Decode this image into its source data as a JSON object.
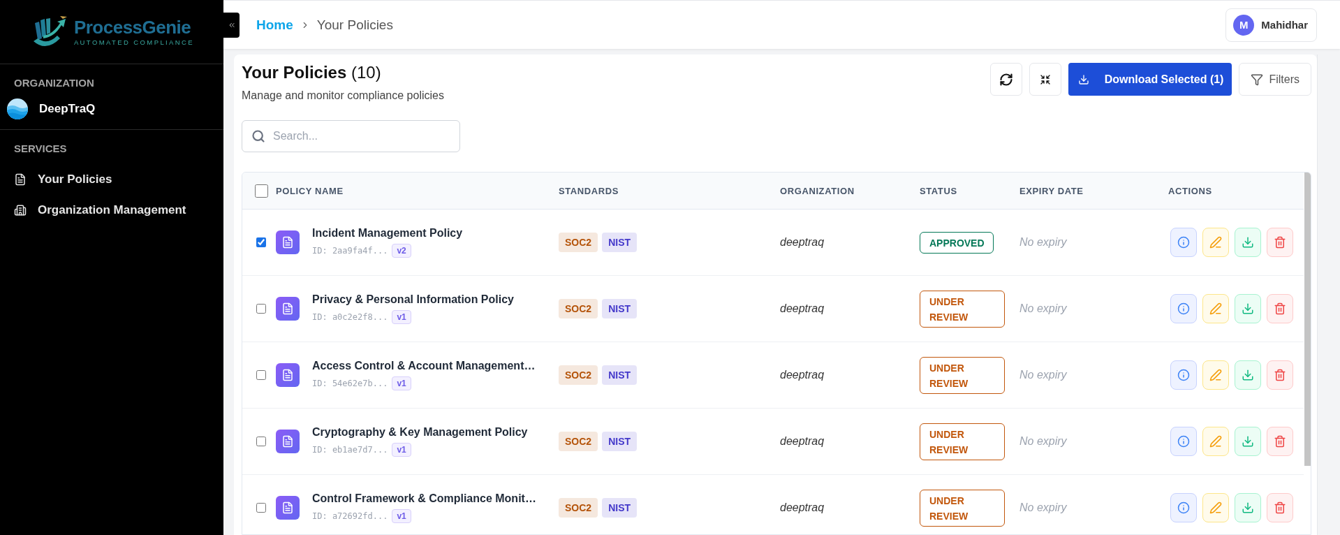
{
  "sidebar": {
    "logo": {
      "name": "ProcessGenie",
      "tagline": "AUTOMATED COMPLIANCE"
    },
    "organization": {
      "heading": "ORGANIZATION",
      "name": "DeepTraQ"
    },
    "services": {
      "heading": "SERVICES",
      "items": [
        {
          "label": "Your Policies",
          "kind": "document"
        },
        {
          "label": "Organization Management",
          "kind": "building"
        }
      ]
    }
  },
  "header": {
    "breadcrumb": [
      {
        "label": "Home",
        "kind": "link"
      },
      {
        "label": "Your Policies",
        "kind": "current"
      }
    ],
    "user": {
      "initial": "M",
      "name": "Mahidhar"
    }
  },
  "page": {
    "title": "Your Policies",
    "count": "(10)",
    "subtitle": "Manage and monitor compliance policies",
    "download_button": "Download Selected (1)",
    "filters_button": "Filters",
    "search": {
      "placeholder": "Search..."
    }
  },
  "table": {
    "select_all": {
      "checked": false
    },
    "columns": [
      "POLICY NAME",
      "STANDARDS",
      "ORGANIZATION",
      "STATUS",
      "EXPIRY DATE",
      "ACTIONS"
    ],
    "rows": [
      {
        "checked": true,
        "name": "Incident Management Policy",
        "id": "ID: 2aa9fa4f...",
        "version": "v2",
        "standards": [
          {
            "label": "SOC2",
            "color": "#b45309"
          },
          {
            "label": "NIST",
            "color": "#4338ca"
          }
        ],
        "organization": "deeptraq",
        "status": {
          "label": "APPROVED",
          "kind": "approved"
        },
        "expiry": "No expiry"
      },
      {
        "checked": false,
        "name": "Privacy & Personal Information Policy",
        "id": "ID: a0c2e2f8...",
        "version": "v1",
        "standards": [
          {
            "label": "SOC2",
            "color": "#b45309"
          },
          {
            "label": "NIST",
            "color": "#4338ca"
          }
        ],
        "organization": "deeptraq",
        "status": {
          "label": "UNDER REVIEW",
          "kind": "review"
        },
        "expiry": "No expiry"
      },
      {
        "checked": false,
        "name": "Access Control & Account Management…",
        "id": "ID: 54e62e7b...",
        "version": "v1",
        "standards": [
          {
            "label": "SOC2",
            "color": "#b45309"
          },
          {
            "label": "NIST",
            "color": "#4338ca"
          }
        ],
        "organization": "deeptraq",
        "status": {
          "label": "UNDER REVIEW",
          "kind": "review"
        },
        "expiry": "No expiry"
      },
      {
        "checked": false,
        "name": "Cryptography & Key Management Policy",
        "id": "ID: eb1ae7d7...",
        "version": "v1",
        "standards": [
          {
            "label": "SOC2",
            "color": "#b45309"
          },
          {
            "label": "NIST",
            "color": "#4338ca"
          }
        ],
        "organization": "deeptraq",
        "status": {
          "label": "UNDER REVIEW",
          "kind": "review"
        },
        "expiry": "No expiry"
      },
      {
        "checked": false,
        "name": "Control Framework & Compliance Monit…",
        "id": "ID: a72692fd...",
        "version": "v1",
        "standards": [
          {
            "label": "SOC2",
            "color": "#b45309"
          },
          {
            "label": "NIST",
            "color": "#4338ca"
          }
        ],
        "organization": "deeptraq",
        "status": {
          "label": "UNDER REVIEW",
          "kind": "review"
        },
        "expiry": "No expiry"
      }
    ]
  }
}
